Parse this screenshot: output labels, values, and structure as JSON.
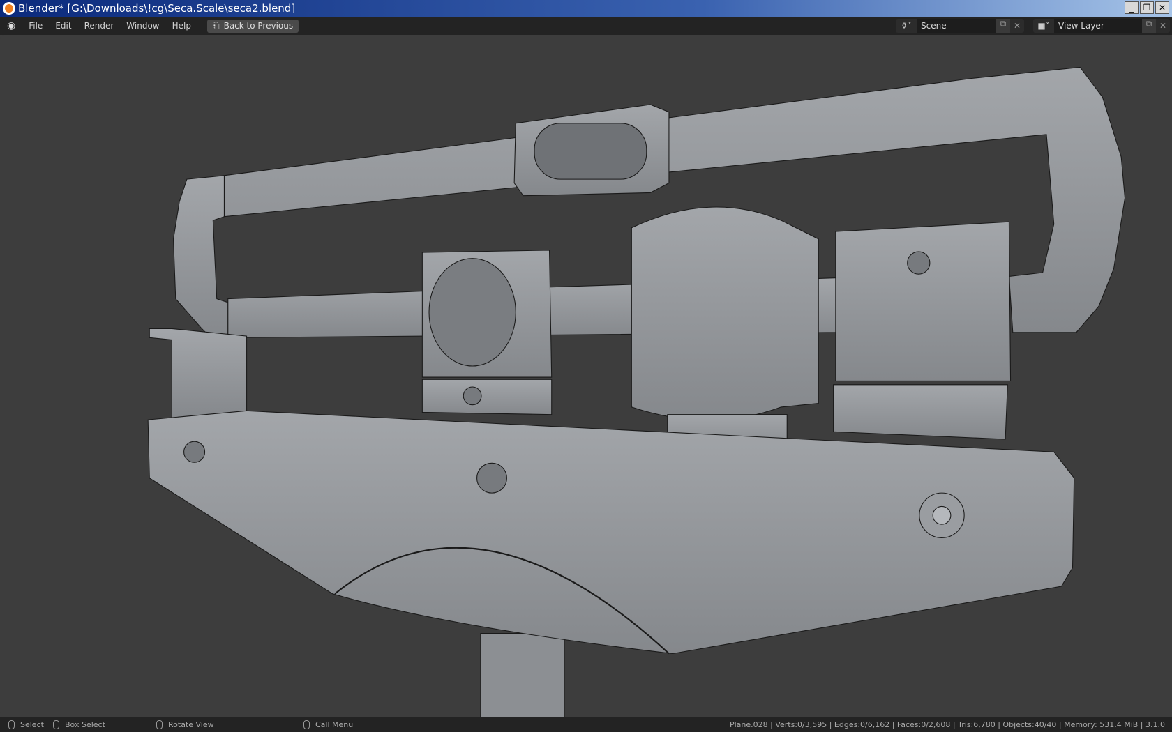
{
  "window": {
    "title": "Blender* [G:\\Downloads\\!cg\\Seca.Scale\\seca2.blend]",
    "controls": [
      "minimize",
      "restore",
      "close"
    ]
  },
  "menu": {
    "items": [
      "File",
      "Edit",
      "Render",
      "Window",
      "Help"
    ],
    "back_label": "Back to Previous"
  },
  "scene": {
    "label": "Scene"
  },
  "view_layer": {
    "label": "View Layer"
  },
  "status": {
    "select": "Select",
    "box_select": "Box Select",
    "rotate": "Rotate View",
    "call_menu": "Call Menu",
    "stats": "Plane.028 | Verts:0/3,595 | Edges:0/6,162 | Faces:0/2,608 | Tris:6,780 | Objects:40/40 | Memory: 531.4 MiB | 3.1.0"
  },
  "colors": {
    "mesh": "#8f9296",
    "background": "#3d3d3d",
    "header": "#232323"
  }
}
